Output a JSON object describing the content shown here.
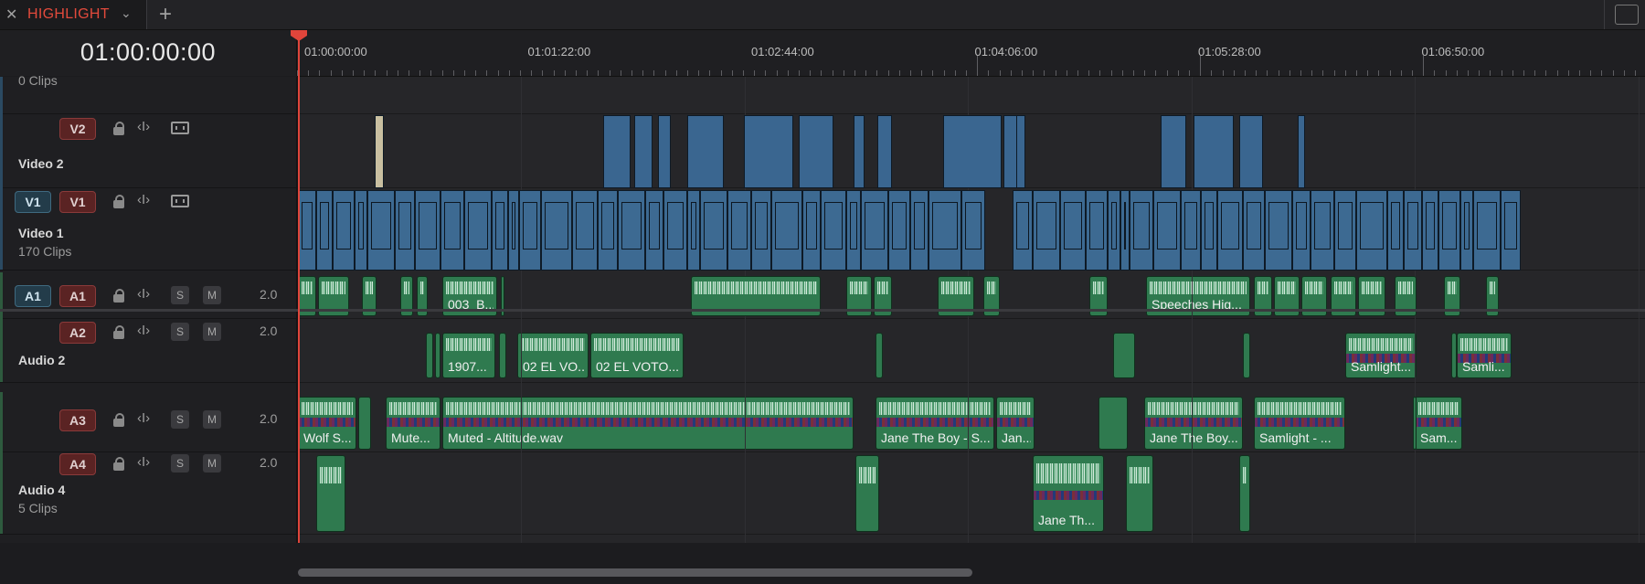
{
  "tab": {
    "close": "✕",
    "title": "HIGHLIGHT",
    "dropdown": "⌄",
    "add": "+"
  },
  "timecode": "01:00:00:00",
  "ruler": {
    "labels": [
      "01:00:00:00",
      "01:01:22:00",
      "01:02:44:00",
      "01:04:06:00",
      "01:05:28:00",
      "01:06:50:00"
    ]
  },
  "tracks": {
    "top_clips": "0 Clips",
    "v2": {
      "btn": "V2",
      "name": "Video 2"
    },
    "v1": {
      "src": "V1",
      "btn": "V1",
      "name": "Video 1",
      "clips": "170 Clips"
    },
    "a1": {
      "src": "A1",
      "btn": "A1",
      "ch": "2.0"
    },
    "a2": {
      "btn": "A2",
      "ch": "2.0",
      "name": "Audio 2"
    },
    "a3": {
      "btn": "A3",
      "ch": "2.0"
    },
    "a4": {
      "btn": "A4",
      "ch": "2.0",
      "name": "Audio 4",
      "clips": "5 Clips"
    },
    "solo": "S",
    "mute": "M"
  },
  "clip_labels": {
    "a1_1": "003_B...",
    "a1_2": "Speeches Hig...",
    "a2_1": "1907...",
    "a2_2": "02 EL VO...",
    "a2_3": "02 EL VOTO...",
    "a2_4": "Samlight...",
    "a2_5": "Samli...",
    "a3_1": "Wolf S...",
    "a3_2": "Mute...",
    "a3_3": "Muted - Altitude.wav",
    "a3_4": "Jane  The Boy - S...",
    "a3_5": "Jan...",
    "a3_6": "Jane  The Boy...",
    "a3_7": "Samlight - ...",
    "a3_8": "Sam...",
    "a4_1": "Jane  Th..."
  },
  "colors": {
    "accent": "#e0453b",
    "video_clip": "#3d6a92",
    "audio_clip": "#2f7a4f"
  },
  "icons": {
    "lock": "lock-icon",
    "trim": "trim-icon",
    "film": "film-icon",
    "playhead": "playhead-icon"
  }
}
